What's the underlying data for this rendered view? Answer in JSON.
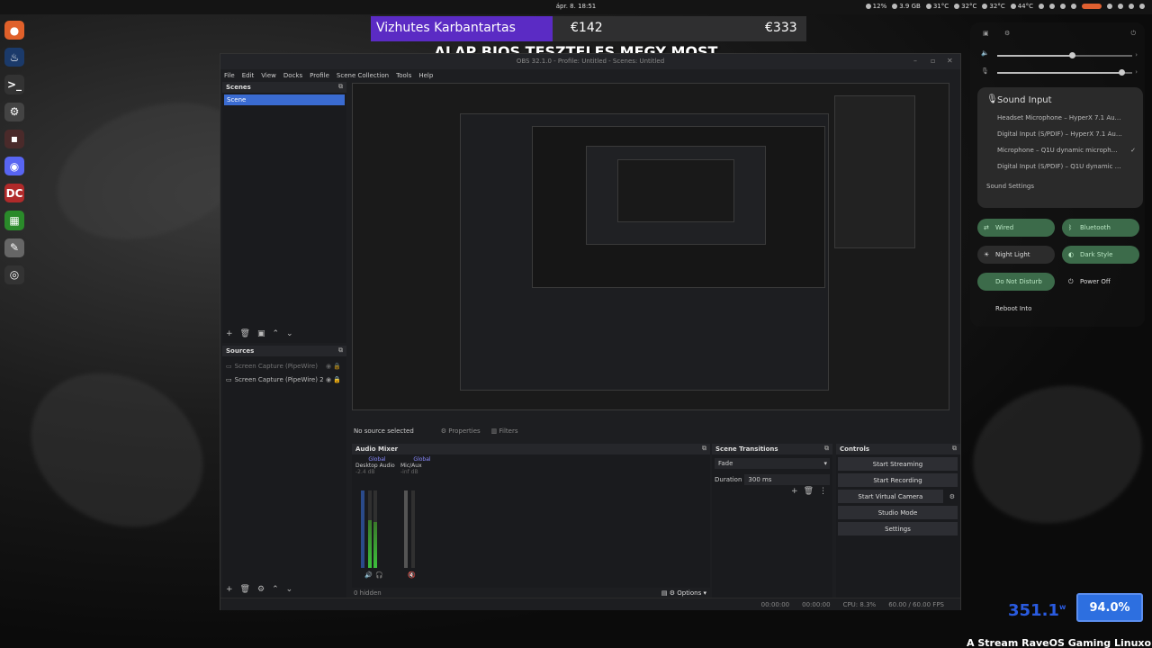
{
  "topbar": {
    "clock": "ápr. 8. 18:51",
    "tray": [
      "12%",
      "3.9 GB",
      "31°C",
      "32°C",
      "32°C",
      "44°C"
    ]
  },
  "dock": [
    {
      "name": "firefox-icon",
      "color": "#e0602a",
      "glyph": "●"
    },
    {
      "name": "steam-icon",
      "color": "#1b3a6a",
      "glyph": "♨"
    },
    {
      "name": "terminal-icon",
      "color": "#333",
      "glyph": ">_"
    },
    {
      "name": "settings-icon",
      "color": "#444",
      "glyph": "⚙"
    },
    {
      "name": "blur-app-icon",
      "color": "#4a2a2a",
      "glyph": "▪"
    },
    {
      "name": "discord-icon",
      "color": "#5865f2",
      "glyph": "◉"
    },
    {
      "name": "davinci-icon",
      "color": "#b02a2a",
      "glyph": "DC"
    },
    {
      "name": "spreadsheet-icon",
      "color": "#2a8a2a",
      "glyph": "▦"
    },
    {
      "name": "text-editor-icon",
      "color": "#666",
      "glyph": "✎"
    },
    {
      "name": "obs-icon",
      "color": "#333",
      "glyph": "◎"
    }
  ],
  "overlay": {
    "banner_name": "Vizhutes Karbantartas",
    "amount1": "€142",
    "amount2": "€333",
    "headline": "ALAP BIOS TESZTELES MEGY MOST Bogyokak"
  },
  "obs": {
    "title": "OBS 32.1.0 - Profile: Untitled - Scenes: Untitled",
    "menu": [
      "File",
      "Edit",
      "View",
      "Docks",
      "Profile",
      "Scene Collection",
      "Tools",
      "Help"
    ],
    "scenes_header": "Scenes",
    "scene_item": "Scene",
    "sources_header": "Sources",
    "sources": [
      {
        "label": "Screen Capture (PipeWire)",
        "dim": true
      },
      {
        "label": "Screen Capture (PipeWire) 2",
        "dim": false
      }
    ],
    "no_source": "No source selected",
    "properties_label": "Properties",
    "filters_label": "Filters",
    "mixer_header": "Audio Mixer",
    "channels": [
      {
        "name": "Desktop Audio",
        "tag": "Global",
        "db": "-2.4 dB",
        "level": 0.62
      },
      {
        "name": "Mic/Aux",
        "tag": "Global",
        "db": "-inf dB",
        "level": 0.0
      }
    ],
    "hidden_count": "0 hidden",
    "options_label": "Options",
    "transitions_header": "Scene Transitions",
    "transition": "Fade",
    "duration_label": "Duration",
    "duration_value": "300 ms",
    "controls_header": "Controls",
    "controls": [
      "Start Streaming",
      "Start Recording",
      "Start Virtual Camera",
      "Studio Mode",
      "Settings"
    ],
    "status": {
      "time1": "00:00:00",
      "time2": "00:00:00",
      "cpu": "CPU: 8.3%",
      "fps": "60.00 / 60.00 FPS"
    }
  },
  "quick_settings": {
    "volume_level": 0.55,
    "mic_level": 0.92,
    "sound_title": "Sound Input",
    "inputs": [
      "Headset Microphone – HyperX 7.1 Au…",
      "Digital Input (S/PDIF) – HyperX 7.1 Au…",
      "Microphone – Q1U dynamic microph…",
      "Digital Input (S/PDIF) – Q1U dynamic …"
    ],
    "sound_settings": "Sound Settings",
    "toggles": [
      {
        "label": "Wired",
        "on": true
      },
      {
        "label": "Bluetooth",
        "on": true
      },
      {
        "label": "Night Light",
        "on": false
      },
      {
        "label": "Dark Style",
        "on": true
      },
      {
        "label": "Do Not Disturb",
        "on": true
      },
      {
        "label": "Power Off",
        "on": false
      },
      {
        "label": "Reboot Into",
        "on": false
      }
    ]
  },
  "bottom": {
    "watts": "351.1",
    "watts_unit": "w",
    "battery": "94.0%",
    "ticker": "A Stream RaveOS Gaming Linuxon fut"
  }
}
